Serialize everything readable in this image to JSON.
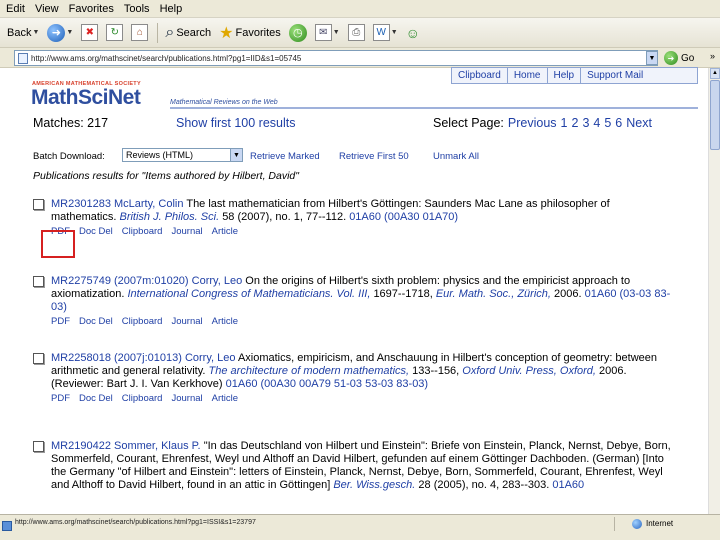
{
  "menu": [
    "Edit",
    "View",
    "Favorites",
    "Tools",
    "Help"
  ],
  "toolbar": {
    "back_label": "Back",
    "search_label": "Search",
    "favorites_label": "Favorites"
  },
  "address": {
    "url": "http://www.ams.org/mathscinet/search/publications.html?pg1=IID&s1=05745",
    "go_label": "Go"
  },
  "header": {
    "ams_text": "AMERICAN MATHEMATICAL SOCIETY",
    "logo_text": "MathSciNet",
    "tagline": "Mathematical Reviews on the Web",
    "nav": [
      "Clipboard",
      "Home",
      "Help",
      "Support Mail"
    ]
  },
  "results": {
    "matches_label": "Matches: 217",
    "show_first": "Show first 100 results",
    "select_page_label": "Select Page:",
    "page_links": [
      "Previous",
      "1",
      "2",
      "3",
      "4",
      "5",
      "6",
      "Next"
    ],
    "batch_label": "Batch Download:",
    "batch_option": "Reviews (HTML)",
    "retrieve_marked": "Retrieve Marked",
    "retrieve_first": "Retrieve First 50",
    "unmark_all": "Unmark All",
    "pub_results": "Publications results for \"Items authored by Hilbert, David\""
  },
  "entries": [
    {
      "mr": "MR2301283",
      "author": "McLarty, Colin",
      "text": "The last mathematician from Hilbert's Göttingen: Saunders Mac Lane as philosopher of mathematics.",
      "journal": "British J. Philos. Sci.",
      "rest": "58 (2007), no. 1, 77--112.",
      "classes": "01A60 (00A30 01A70)",
      "links": [
        "PDF",
        "Doc Del",
        "Clipboard",
        "Journal",
        "Article"
      ]
    },
    {
      "mr": "MR2275749 (2007m:01020)",
      "author": "Corry, Leo",
      "text": "On the origins of Hilbert's sixth problem: physics and the empiricist approach to axiomatization.",
      "journal": "International Congress of Mathematicians. Vol. III,",
      "rest": "1697--1718,",
      "publisher": "Eur. Math. Soc., Zürich,",
      "rest2": "2006.",
      "classes": "01A60 (03-03 83-03)",
      "links": [
        "PDF",
        "Doc Del",
        "Clipboard",
        "Journal",
        "Article"
      ]
    },
    {
      "mr": "MR2258018 (2007j:01013)",
      "author": "Corry, Leo",
      "text": "Axiomatics, empiricism, and Anschauung in Hilbert's conception of geometry: between arithmetic and general relativity.",
      "journal": "The architecture of modern mathematics,",
      "rest": "133--156,",
      "publisher": "Oxford Univ. Press, Oxford,",
      "rest2": "2006. (Reviewer: Bart J. I. Van Kerkhove)",
      "classes": "01A60 (00A30 00A79 51-03 53-03 83-03)",
      "links": [
        "PDF",
        "Doc Del",
        "Clipboard",
        "Journal",
        "Article"
      ]
    },
    {
      "mr": "MR2190422",
      "author": "Sommer, Klaus P.",
      "text": "\"In das Deutschland von Hilbert und Einstein\": Briefe von Einstein, Planck, Nernst, Debye, Born, Sommerfeld, Courant, Ehrenfest, Weyl und Althoff an David Hilbert, gefunden auf einem Göttinger Dachboden. (German) [Into the Germany \"of Hilbert and Einstein\": letters of Einstein, Planck, Nernst, Debye, Born, Sommerfeld, Courant, Ehrenfest, Weyl and Althoff to David Hilbert, found in an attic in Göttingen]",
      "journal": "Ber. Wiss.gesch.",
      "rest": "28 (2005), no. 4, 283--303.",
      "classes": "01A60",
      "links": []
    }
  ],
  "status": {
    "url": "http://www.ams.org/mathscinet/search/publications.html?pg1=ISSI&s1=23797",
    "zone": "Internet"
  }
}
